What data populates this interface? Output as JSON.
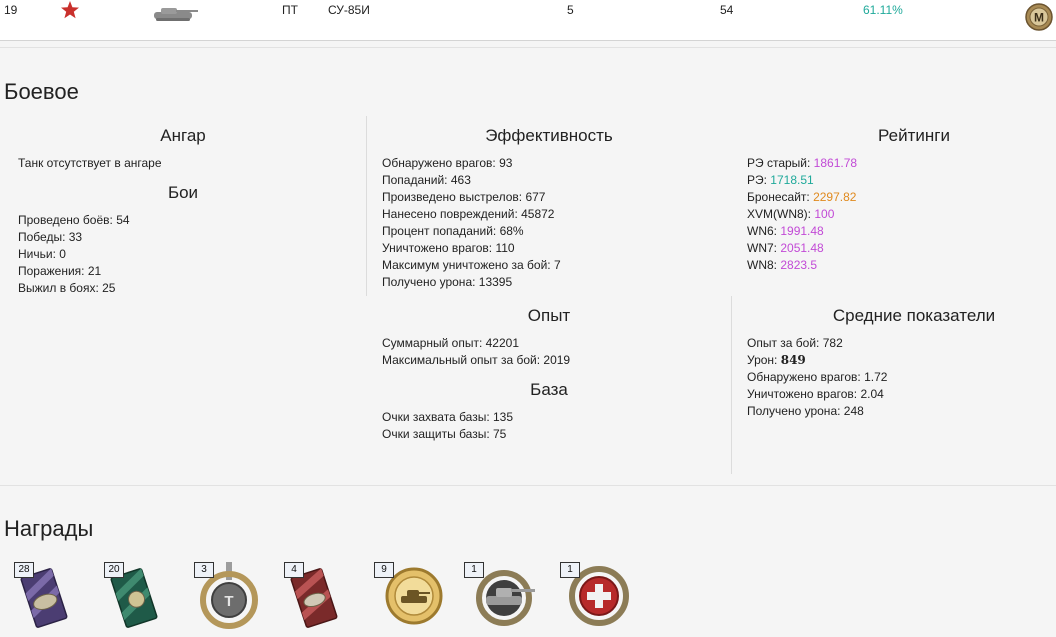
{
  "top_row": {
    "number": "19",
    "type": "ПТ",
    "tank_name": "СУ-85И",
    "col5": "5",
    "col6": "54",
    "win_rate": "61.11%",
    "win_rate_color": "#1fa99a",
    "mastery_badge": "М"
  },
  "combat": {
    "title": "Боевое",
    "hangar": {
      "title": "Ангар",
      "status": "Танк отсутствует в ангаре"
    },
    "battles": {
      "title": "Бои",
      "items": [
        "Проведено боёв: 54",
        "Победы: 33",
        "Ничьи: 0",
        "Поражения: 21",
        "Выжил в боях: 25"
      ]
    },
    "efficiency": {
      "title": "Эффективность",
      "items": [
        "Обнаружено врагов: 93",
        "Попаданий: 463",
        "Произведено выстрелов: 677",
        "Нанесено повреждений: 45872",
        "Процент попаданий: 68%",
        "Уничтожено врагов: 110",
        "Максимум уничтожено за бой: 7",
        "Получено урона: 13395"
      ]
    },
    "ratings": {
      "title": "Рейтинги",
      "items": [
        {
          "label": "РЭ старый: ",
          "value": "1861.78",
          "color": "#c24ad6"
        },
        {
          "label": "РЭ: ",
          "value": "1718.51",
          "color": "#1fa99a"
        },
        {
          "label": "Бронесайт: ",
          "value": "2297.82",
          "color": "#e08a1e"
        },
        {
          "label": "XVM(WN8): ",
          "value": "100",
          "color": "#c24ad6"
        },
        {
          "label": "WN6: ",
          "value": "1991.48",
          "color": "#c24ad6"
        },
        {
          "label": "WN7: ",
          "value": "2051.48",
          "color": "#c24ad6"
        },
        {
          "label": "WN8: ",
          "value": "2823.5",
          "color": "#c24ad6"
        }
      ]
    },
    "experience": {
      "title": "Опыт",
      "items": [
        "Суммарный опыт: 42201",
        "Максимальный опыт за бой: 2019"
      ]
    },
    "base": {
      "title": "База",
      "items": [
        "Очки захвата базы: 135",
        "Очки защиты базы: 75"
      ]
    },
    "averages": {
      "title": "Средние показатели",
      "exp": "Опыт за бой: 782",
      "damage_label": "Урон: ",
      "damage_value": "849",
      "spotted": "Обнаружено врагов: 1.72",
      "destroyed": "Уничтожено врагов: 2.04",
      "received": "Получено урона: 248"
    }
  },
  "awards": {
    "title": "Награды",
    "items": [
      {
        "count": "28",
        "icon": "medal-card-purple-icon"
      },
      {
        "count": "20",
        "icon": "medal-card-green-icon"
      },
      {
        "count": "3",
        "icon": "medal-wot-wreath-icon"
      },
      {
        "count": "4",
        "icon": "medal-card-red-icon"
      },
      {
        "count": "9",
        "icon": "medal-gold-tank-icon"
      },
      {
        "count": "1",
        "icon": "medal-tank-wreath-icon"
      },
      {
        "count": "1",
        "icon": "medal-red-cross-icon"
      }
    ]
  }
}
